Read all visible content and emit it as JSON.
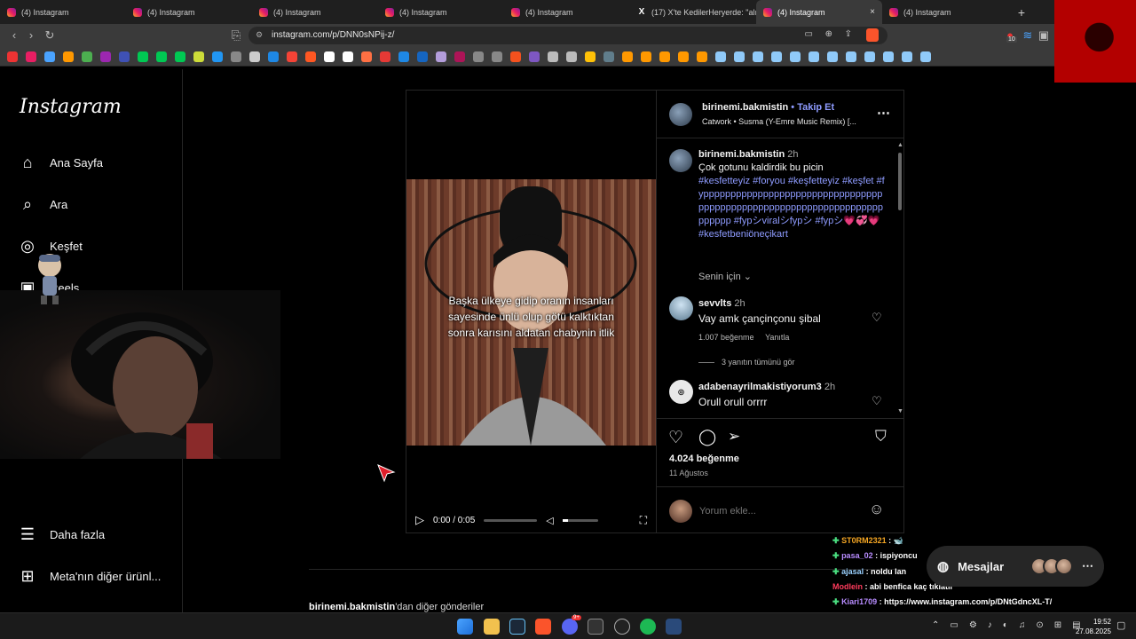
{
  "browser": {
    "tabs": [
      {
        "label": "(4) Instagram",
        "icon": "instagram-icon",
        "active": false
      },
      {
        "label": "(4) Instagram",
        "icon": "instagram-icon",
        "active": false
      },
      {
        "label": "(4) Instagram",
        "icon": "instagram-icon",
        "active": false
      },
      {
        "label": "(4) Instagram",
        "icon": "instagram-icon",
        "active": false
      },
      {
        "label": "(4) Instagram",
        "icon": "instagram-icon",
        "active": false
      },
      {
        "label": "(17) X'te KedilerHeryerde: \"alık",
        "icon": "x-icon",
        "active": false
      },
      {
        "label": "(4) Instagram",
        "icon": "instagram-icon",
        "active": true
      },
      {
        "label": "(4) Instagram",
        "icon": "instagram-icon",
        "active": false
      }
    ],
    "new_tab": "+",
    "close_tab": "×",
    "url": "instagram.com/p/DNN0sNPij-z/",
    "extension_badge": "10"
  },
  "sidebar": {
    "logo": "Instagram",
    "items": [
      {
        "label": "Ana Sayfa",
        "icon": "home-icon"
      },
      {
        "label": "Ara",
        "icon": "search-icon"
      },
      {
        "label": "Keşfet",
        "icon": "compass-icon"
      },
      {
        "label": "Reels",
        "icon": "reels-icon"
      }
    ],
    "bottom": [
      {
        "label": "Daha fazla",
        "icon": "menu-icon"
      },
      {
        "label": "Meta'nın diğer ürünl...",
        "icon": "apps-icon"
      }
    ]
  },
  "post": {
    "author": "birinemi.bakmistin",
    "follow": "Takip Et",
    "audio": "Catwork • Susma (Y-Emre Music Remix) [...",
    "image_caption": [
      "Başka ülkeye gidip oranın insanları",
      "sayesinde ünlü olup götü kalktıktan",
      "sonra karısını aldatan chabynin itlik"
    ],
    "video_time": "0:00 / 0:05",
    "caption": {
      "author": "birinemi.bakmistin",
      "time": "2h",
      "text": "Çok gotunu kaldirdik bu picin",
      "tags": "#kesfetteyiz #foryou #keşfetteyiz #keşfet #fyppppppppppppppppppppppppppppppppppppppppppppppppppppppppppppppppppppppppp #fypシviralシfypシ #fypシ💗💞💗 #kesfetbeniöneçikart"
    },
    "for_you": "Senin için",
    "comments": [
      {
        "author": "sevvlts",
        "time": "2h",
        "text": "Vay amk çançinçonu şibal",
        "likes": "1.007 beğenme",
        "reply": "Yanıtla",
        "view_replies": "3 yanıtın tümünü gör"
      },
      {
        "author": "adabenayrilmakistiyorum3",
        "time": "2h",
        "text": "Orull orull orrrr"
      }
    ],
    "likes": "4.024 beğenme",
    "date": "11 Ağustos",
    "comment_placeholder": "Yorum ekle..."
  },
  "more_posts": {
    "author": "birinemi.bakmistin",
    "suffix": "'dan diğer gönderiler"
  },
  "chat": [
    {
      "user": "ST0RM2321",
      "text": " : 🐋",
      "color": "#f5a623"
    },
    {
      "user": "pasa_02",
      "text": " : ispiyoncu",
      "color": "#b88cff"
    },
    {
      "user": "ajasal",
      "text": " : noldu lan",
      "color": "#9ad1ff"
    },
    {
      "user": "Modlein",
      "text": " : abi benfica kaç tıklatır",
      "color": "#ff3b5c"
    },
    {
      "user": "Kiari1709",
      "text": " : https://www.instagram.com/p/DNtGdncXL-T/",
      "color": "#b88cff"
    }
  ],
  "messages": {
    "label": "Mesajlar"
  },
  "taskbar": {
    "time": "19:52",
    "date": "27.08.2025",
    "discord_badge": "9+"
  }
}
